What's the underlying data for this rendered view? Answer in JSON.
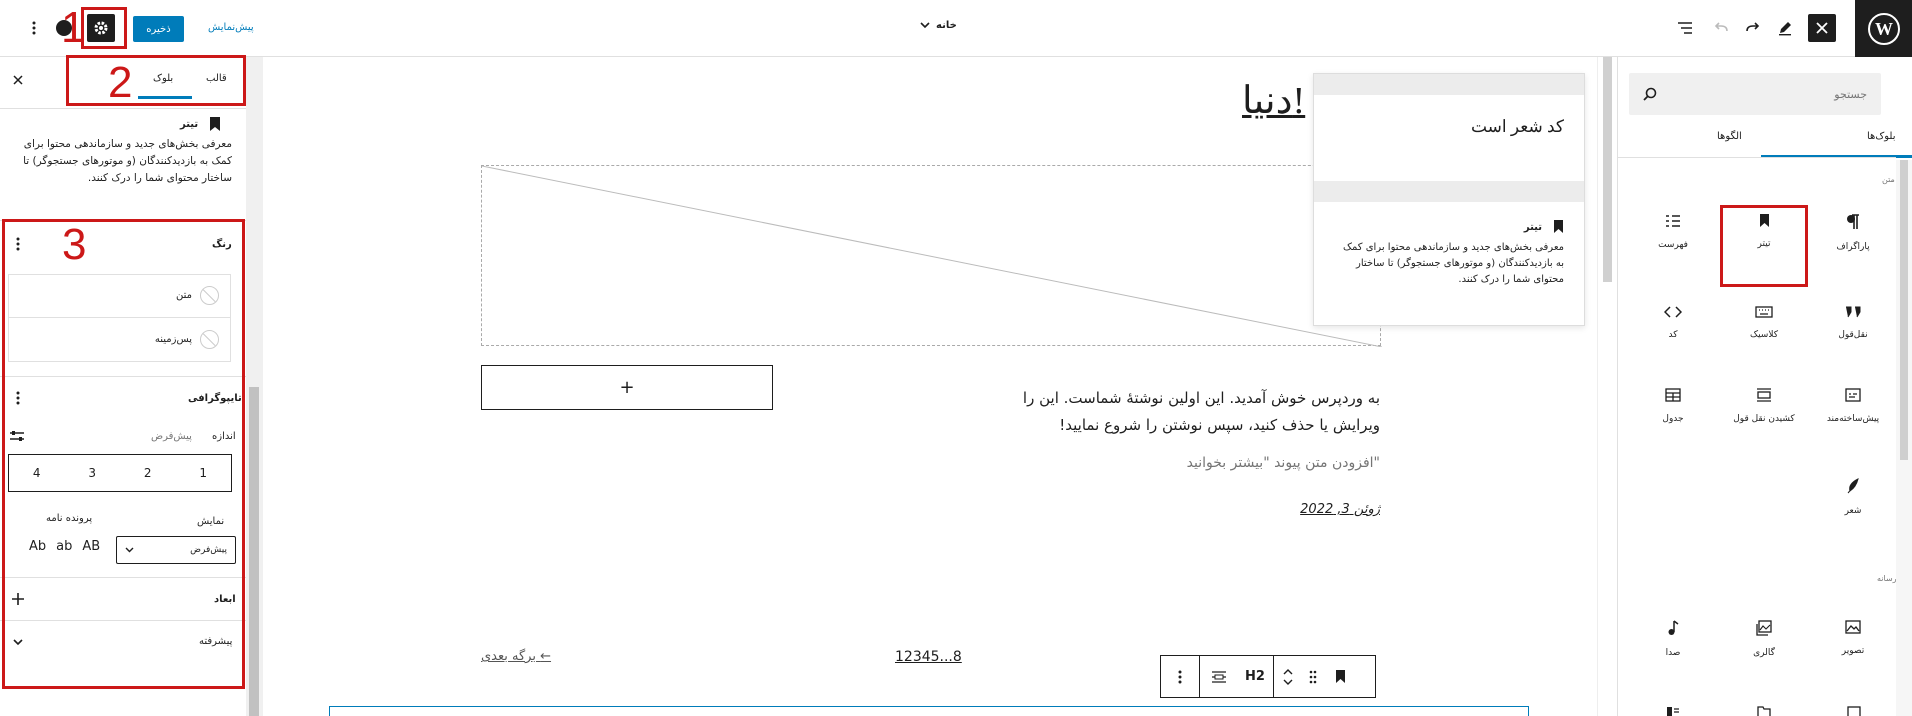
{
  "topbar": {
    "save_label": "ذخیره",
    "preview_label": "پیش‌نمایش",
    "document_title": "خانه"
  },
  "annotations": [
    "1",
    "2",
    "3"
  ],
  "settings": {
    "tabs": [
      {
        "label": "قالب"
      },
      {
        "label": "بلوک"
      }
    ],
    "block_name": "تیتر",
    "block_description": "معرفی بخش‌های جدید و سازماندهی محتوا برای کمک به بازدیدکنندگان (و موتورهای جستجوگر) تا ساختار محتوای شما را درک کنند.",
    "color_panel": {
      "title": "رنگ",
      "items": [
        {
          "label": "متن"
        },
        {
          "label": "پس‌زمینه"
        }
      ]
    },
    "typography_panel": {
      "title": "تایپوگرافی",
      "size_label": "اندازه",
      "size_value": "پیش‌فرض",
      "size_options": [
        "1",
        "2",
        "3",
        "4"
      ],
      "appearance_label": "نمایش",
      "appearance_value": "پیش‌فرض",
      "letter_case_label": "پرونده نامه",
      "letter_case_options": [
        "AB",
        "ab",
        "Ab"
      ]
    },
    "dimensions_title": "ابعاد",
    "advanced_title": "پیشرفته"
  },
  "canvas": {
    "heading": "دنیا!",
    "post_text": "به وردپرس خوش آمدید. این اولین نوشتهٔ شماست. این را ویرایش یا حذف کنید، سپس نوشتن را شروع نمایید!",
    "more_link": "افزودن متن پیوند \"بیشتر بخوانید\"",
    "post_date": "ژوئن 3, 2022",
    "next_page": "برگه بعدی",
    "page_numbers": "12345...8",
    "append_symbol": "+",
    "toolbar_heading_level": "H2",
    "preview": {
      "poem_text": "کد شعر است",
      "block_name": "تیتر",
      "block_description": "معرفی بخش‌های جدید و سازماندهی محتوا برای کمک به بازدیدکنندگان (و موتورهای جستجوگر) تا ساختار محتوای شما را درک کنند."
    }
  },
  "inserter": {
    "search_placeholder": "جستجو",
    "tabs": [
      {
        "label": "بلوک‌ها"
      },
      {
        "label": "الگوها"
      }
    ],
    "categories": [
      {
        "label": "متن"
      },
      {
        "label": "رسانه"
      }
    ],
    "text_blocks": [
      {
        "label": "پاراگراف",
        "icon": "paragraph-icon"
      },
      {
        "label": "تیتر",
        "icon": "bookmark-icon"
      },
      {
        "label": "فهرست",
        "icon": "list-icon"
      },
      {
        "label": "نقل‌قول",
        "icon": "quote-icon"
      },
      {
        "label": "کلاسیک",
        "icon": "keyboard-icon"
      },
      {
        "label": "کد",
        "icon": "code-icon"
      },
      {
        "label": "پیش‌ساخته‌مند",
        "icon": "preformatted-icon"
      },
      {
        "label": "کشیدن نقل قول",
        "icon": "pullquote-icon"
      },
      {
        "label": "جدول",
        "icon": "table-icon"
      },
      {
        "label": "شعر",
        "icon": "feather-icon"
      }
    ],
    "media_blocks": [
      {
        "label": "تصویر",
        "icon": "image-icon"
      },
      {
        "label": "گالری",
        "icon": "gallery-icon"
      },
      {
        "label": "صدا",
        "icon": "audio-icon"
      }
    ]
  },
  "colors": {
    "accent": "#007cba",
    "annotation": "#cc1818",
    "toolbar_dark": "#1e1e1e"
  }
}
